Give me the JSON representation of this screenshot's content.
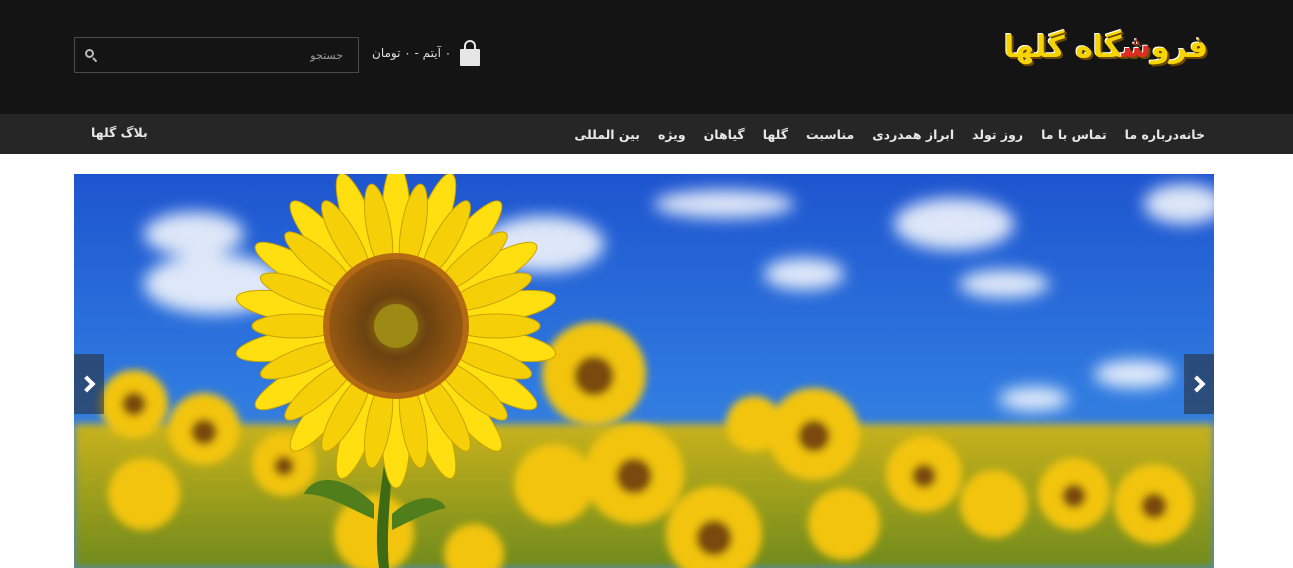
{
  "header": {
    "logo": {
      "part1": "فرو",
      "accent": "ش",
      "part2": "گاه گلها"
    },
    "cart": {
      "text": "۰ آیتم - ۰ تومان",
      "icon": "shopping-bag-icon"
    },
    "search": {
      "placeholder": "جستجو",
      "value": "",
      "icon": "search-icon"
    }
  },
  "nav": {
    "items": [
      {
        "label": "خانه"
      },
      {
        "label": "درباره ما"
      },
      {
        "label": "تماس با ما"
      },
      {
        "label": "روز تولد"
      },
      {
        "label": "ابراز همدردی"
      },
      {
        "label": "مناسبت"
      },
      {
        "label": "گلها"
      },
      {
        "label": "گیاهان"
      },
      {
        "label": "ویژه"
      },
      {
        "label": "بین المللی"
      }
    ],
    "blog_label": "بلاگ گلها"
  },
  "slider": {
    "image": "sunflower-field-photo",
    "prev_icon": "chevron-left-icon",
    "next_icon": "chevron-right-icon"
  },
  "colors": {
    "header_bg": "#141414",
    "nav_bg": "#262626",
    "logo_yellow": "#f5d400",
    "logo_red": "#e02b20",
    "sky_blue": "#1f5fd1"
  }
}
